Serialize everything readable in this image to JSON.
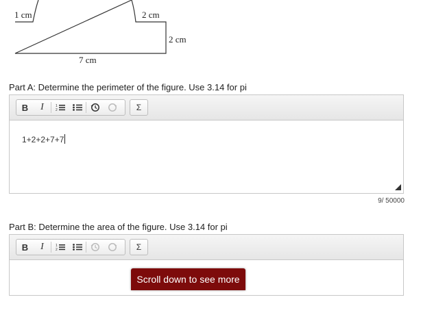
{
  "figure": {
    "labels": {
      "left_step": "1 cm",
      "right_step": "2 cm",
      "right_side": "2 cm",
      "bottom": "7 cm"
    }
  },
  "part_a": {
    "question": "Part A: Determine the perimeter of the figure. Use 3.14 for pi",
    "toolbar": {
      "bold": "B",
      "italic": "I",
      "math": "Σ"
    },
    "answer": "1+2+2+7+7",
    "counter": "9/ 50000"
  },
  "part_b": {
    "question": "Part B: Determine the area of the figure. Use 3.14 for pi",
    "toolbar": {
      "bold": "B",
      "italic": "I",
      "math": "Σ"
    },
    "answer": ""
  },
  "scroll_prompt": {
    "label": "Scroll down to see more",
    "color": "#7d0b0b"
  }
}
